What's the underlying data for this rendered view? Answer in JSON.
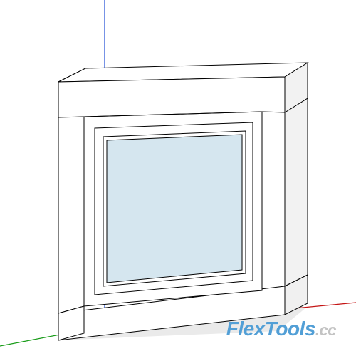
{
  "scene": {
    "object": "window-component",
    "axes_visible": true
  },
  "watermark": {
    "brand": "FlexTools",
    "ext": ".cc"
  },
  "colors": {
    "axis_blue": "#1d4cd6",
    "axis_red": "#c41414",
    "axis_green": "#189c18",
    "glass_fill": "#d5e6ef",
    "frame_fill": "#ffffff",
    "edge": "#000000",
    "shadow": "#e8e8e8",
    "wm_main": "#529fd6",
    "wm_ext": "#c3c3c3"
  }
}
